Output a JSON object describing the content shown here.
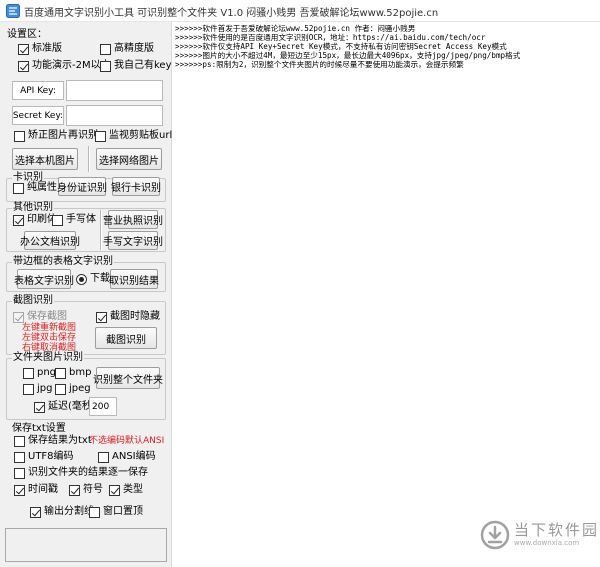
{
  "window": {
    "title": "百度通用文字识别小工具 可识别整个文件夹 V1.0   闷骚小贱男    吾爱破解论坛www.52pojie.cn",
    "icon": "app-icon"
  },
  "settings": {
    "section_label": "设置区：",
    "standard": {
      "label": "标准版",
      "checked": true
    },
    "high_precision": {
      "label": "高精度版",
      "checked": false
    },
    "demo": {
      "label": "功能演示-2M以内",
      "checked": true
    },
    "own_key": {
      "label": "我自己有key",
      "checked": false
    },
    "api_key_label": "API Key:",
    "api_key_value": "",
    "secret_key_label": "Secret Key:",
    "secret_key_value": "",
    "correct_image": {
      "label": "矫正图片再识别",
      "checked": false
    },
    "monitor_clipboard": {
      "label": "监视剪贴板url",
      "checked": false
    },
    "select_local_btn": "选择本机图片",
    "select_network_btn": "选择网络图片"
  },
  "card": {
    "title": "卡识别",
    "pure_attr": {
      "label": "纯属性",
      "checked": false
    },
    "id_card_btn": "身份证识别",
    "bank_card_btn": "银行卡识别"
  },
  "other": {
    "title": "其他识别",
    "print": {
      "label": "印刷体",
      "checked": true
    },
    "handwriting": {
      "label": "手写体",
      "checked": false
    },
    "business_license_btn": "营业执照识别",
    "office_doc_btn": "办公文档识别",
    "handwriting_btn": "手写文字识别"
  },
  "table": {
    "title": "带边框的表格文字识别",
    "table_btn": "表格文字识别",
    "download": {
      "label": "下载",
      "checked": true
    },
    "fetch_btn": "取识别结果"
  },
  "screenshot": {
    "title": "截图识别",
    "save_screenshot": {
      "label": "保存截图",
      "checked": true
    },
    "hide_on_capture": {
      "label": "截图时隐藏",
      "checked": true
    },
    "hint_lines": [
      "左键重新截图",
      "左键双击保存",
      "右键取消截图"
    ],
    "screenshot_btn": "截图识别"
  },
  "folder": {
    "title": "文件夹图片识别",
    "png": {
      "label": "png",
      "checked": false
    },
    "bmp": {
      "label": "bmp",
      "checked": false
    },
    "jpg": {
      "label": "jpg",
      "checked": false
    },
    "jpeg": {
      "label": "jpeg",
      "checked": false
    },
    "recognize_folder_btn": "识别整个文件夹",
    "delay": {
      "label": "延迟(毫秒)",
      "checked": true
    },
    "delay_value": "200"
  },
  "txt": {
    "title": "保存txt设置",
    "save_txt": {
      "label": "保存结果为txt",
      "checked": false
    },
    "save_note": "不选编码默认ANSI",
    "utf8": {
      "label": "UTF8编码",
      "checked": false
    },
    "ansi": {
      "label": "ANSI编码",
      "checked": false
    },
    "append_folder": {
      "label": "识别文件夹的结果逐一保存",
      "checked": false
    },
    "timestamp": {
      "label": "时间戳",
      "checked": true
    },
    "symbol": {
      "label": "符号",
      "checked": true
    },
    "type": {
      "label": "类型",
      "checked": true
    }
  },
  "bottom": {
    "output_separator": {
      "label": "输出分割线",
      "checked": true
    },
    "window_on_top": {
      "label": "窗口置顶",
      "checked": false
    }
  },
  "log_lines": [
    ">>>>>>软件首发于吾爱破解论坛www.52pojie.cn  作者：闷骚小贱男",
    ">>>>>>软件使用的是百度通用文字识别OCR，地址：https://ai.baidu.com/tech/ocr",
    ">>>>>>软件仅支持API Key+Secret Key模式，不支持私有访问密钥Secret Access Key模式",
    ">>>>>>图片的大小不超过4M，最短边至少15px，最长边最大4096px，支持jpg/jpeg/png/bmp格式",
    ">>>>>>ps:限制为2，识别整个文件夹图片的时候尽量不要使用功能演示，会提示频繁"
  ],
  "watermark": {
    "main": "当下软件园",
    "sub": "www.downxia.com",
    "logo": "downxia-logo-icon"
  },
  "colors": {
    "accent_red": "#e02020",
    "panel_bg": "#f0f0f0"
  }
}
